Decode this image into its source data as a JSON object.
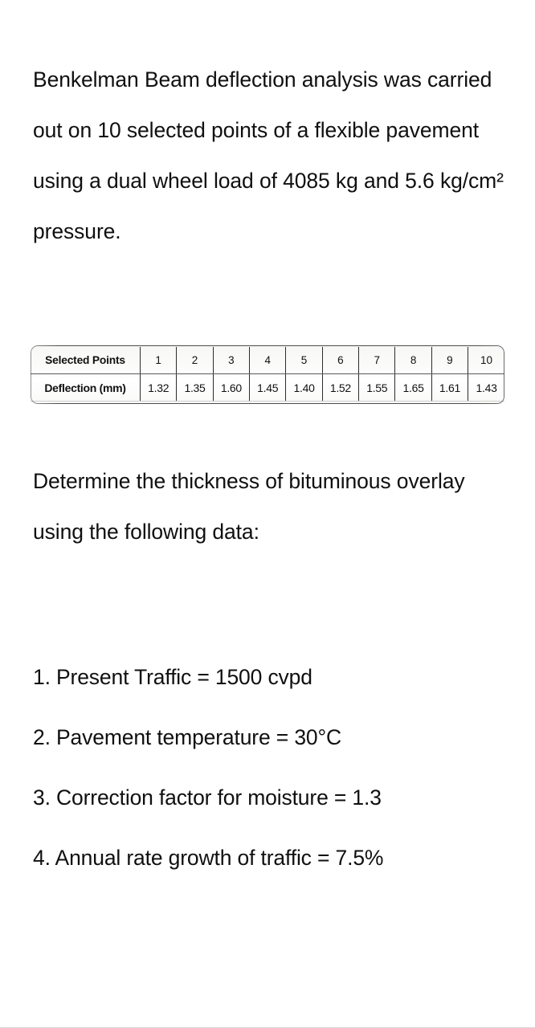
{
  "document": {
    "intro_paragraph": "Benkelman Beam deflection analysis was carried out on 10 selected points of a flexible pavement using a dual wheel load of 4085 kg and 5.6 kg/cm² pressure.",
    "determine_paragraph": "Determine the thickness of bituminous overlay using the following data:"
  },
  "table": {
    "row_labels": [
      "Selected Points",
      "Deflection (mm)"
    ],
    "selected_points": [
      "1",
      "2",
      "3",
      "4",
      "5",
      "6",
      "7",
      "8",
      "9",
      "10"
    ],
    "deflection_mm": [
      "1.32",
      "1.35",
      "1.60",
      "1.45",
      "1.40",
      "1.52",
      "1.55",
      "1.65",
      "1.61",
      "1.43"
    ]
  },
  "given_data": [
    "1. Present Traffic = 1500 cvpd",
    "2. Pavement temperature = 30°C",
    "3. Correction factor for moisture = 1.3",
    "4. Annual rate growth of traffic = 7.5%"
  ],
  "chart_data": {
    "type": "table",
    "title": "Benkelman Beam deflection measurements",
    "columns": [
      "Selected Points",
      "1",
      "2",
      "3",
      "4",
      "5",
      "6",
      "7",
      "8",
      "9",
      "10"
    ],
    "rows": [
      [
        "Deflection (mm)",
        "1.32",
        "1.35",
        "1.60",
        "1.45",
        "1.40",
        "1.52",
        "1.55",
        "1.65",
        "1.61",
        "1.43"
      ]
    ],
    "x": [
      1,
      2,
      3,
      4,
      5,
      6,
      7,
      8,
      9,
      10
    ],
    "values": [
      1.32,
      1.35,
      1.6,
      1.45,
      1.4,
      1.52,
      1.55,
      1.65,
      1.61,
      1.43
    ],
    "xlabel": "Selected Points",
    "ylabel": "Deflection (mm)"
  },
  "colors": {
    "page_background": "#ffffff",
    "text": "#101010",
    "table_border": "#2c2c2c",
    "scan_tint": "#f7f7f6"
  }
}
